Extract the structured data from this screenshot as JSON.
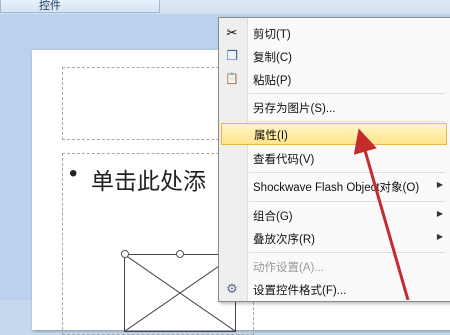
{
  "ribbon": {
    "tab_label": "控件"
  },
  "slide": {
    "title_char": "单",
    "bullet": "•",
    "body_text": "单击此处添"
  },
  "context_menu": {
    "items": [
      {
        "label": "剪切(T)",
        "icon": "scissors-icon",
        "glyph": "✂",
        "enabled": true
      },
      {
        "label": "复制(C)",
        "icon": "copy-icon",
        "glyph": "❐",
        "enabled": true
      },
      {
        "label": "粘贴(P)",
        "icon": "paste-icon",
        "glyph": "📋",
        "enabled": true
      },
      {
        "label": "另存为图片(S)...",
        "enabled": true
      },
      {
        "label": "属性(I)",
        "enabled": true,
        "highlighted": true
      },
      {
        "label": "查看代码(V)",
        "enabled": true
      },
      {
        "label": "Shockwave Flash Object对象(O)",
        "enabled": true,
        "submenu": true
      },
      {
        "label": "组合(G)",
        "enabled": true,
        "submenu": true
      },
      {
        "label": "叠放次序(R)",
        "enabled": true,
        "submenu": true
      },
      {
        "label": "动作设置(A)...",
        "enabled": false
      },
      {
        "label": "设置控件格式(F)...",
        "icon": "format-control-icon",
        "glyph": "⚙",
        "enabled": true
      }
    ]
  },
  "colors": {
    "highlight": "#ffe48a",
    "annotation_arrow": "#c42b2b"
  }
}
